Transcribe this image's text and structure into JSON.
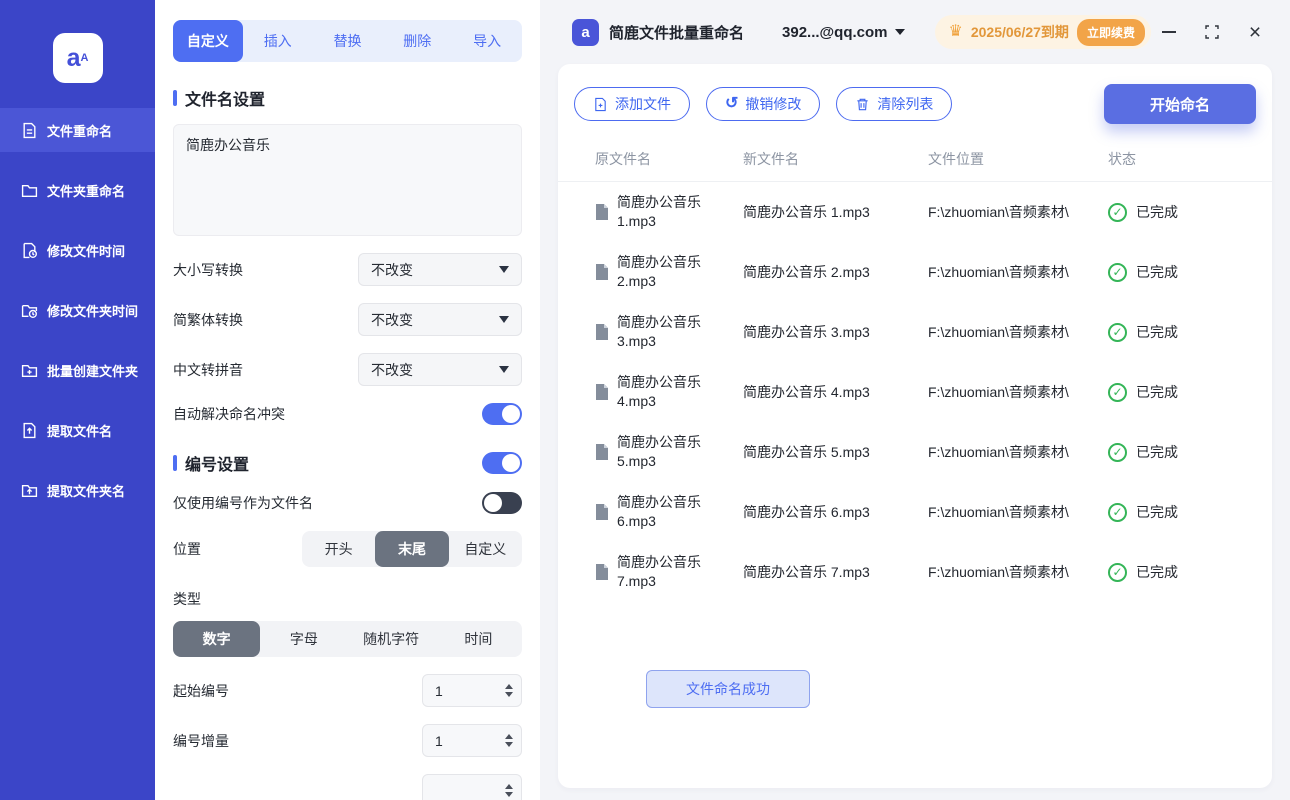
{
  "colors": {
    "accent": "#4e6ef2",
    "sidebar": "#3b45c8",
    "success": "#35b558",
    "warning": "#f0a23c"
  },
  "icons": {
    "check": "✓",
    "undo": "↺",
    "crown": "♛",
    "close": "×"
  },
  "titlebar": {
    "app_title": "简鹿文件批量重命名",
    "account": "392...@qq.com",
    "expiry": "2025/06/27到期",
    "renew": "立即续费"
  },
  "sidebar": {
    "items": [
      {
        "label": "文件重命名"
      },
      {
        "label": "文件夹重命名"
      },
      {
        "label": "修改文件时间"
      },
      {
        "label": "修改文件夹时间"
      },
      {
        "label": "批量创建文件夹"
      },
      {
        "label": "提取文件名"
      },
      {
        "label": "提取文件夹名"
      }
    ]
  },
  "tabs": [
    "自定义",
    "插入",
    "替换",
    "删除",
    "导入"
  ],
  "panel": {
    "filename_title": "文件名设置",
    "filename_value": "简鹿办公音乐",
    "fields": [
      {
        "label": "大小写转换",
        "value": "不改变"
      },
      {
        "label": "简繁体转换",
        "value": "不改变"
      },
      {
        "label": "中文转拼音",
        "value": "不改变"
      }
    ],
    "auto_resolve_label": "自动解决命名冲突",
    "numbering_title": "编号设置",
    "only_number_label": "仅使用编号作为文件名",
    "position": {
      "label": "位置",
      "options": [
        "开头",
        "末尾",
        "自定义"
      ],
      "selected": "末尾"
    },
    "type": {
      "label": "类型",
      "options": [
        "数字",
        "字母",
        "随机字符",
        "时间"
      ],
      "selected": "数字"
    },
    "start_number": {
      "label": "起始编号",
      "value": "1"
    },
    "increment": {
      "label": "编号增量",
      "value": "1"
    }
  },
  "main": {
    "toolbar": {
      "add_files": "添加文件",
      "undo": "撤销修改",
      "clear": "清除列表",
      "start": "开始命名"
    },
    "table": {
      "headers": [
        "原文件名",
        "新文件名",
        "文件位置",
        "状态"
      ],
      "rows": [
        {
          "original": "简鹿办公音乐 1.mp3",
          "new": "简鹿办公音乐 1.mp3",
          "location": "F:\\zhuomian\\音频素材\\",
          "status": "已完成"
        },
        {
          "original": "简鹿办公音乐 2.mp3",
          "new": "简鹿办公音乐 2.mp3",
          "location": "F:\\zhuomian\\音频素材\\",
          "status": "已完成"
        },
        {
          "original": "简鹿办公音乐 3.mp3",
          "new": "简鹿办公音乐 3.mp3",
          "location": "F:\\zhuomian\\音频素材\\",
          "status": "已完成"
        },
        {
          "original": "简鹿办公音乐 4.mp3",
          "new": "简鹿办公音乐 4.mp3",
          "location": "F:\\zhuomian\\音频素材\\",
          "status": "已完成"
        },
        {
          "original": "简鹿办公音乐 5.mp3",
          "new": "简鹿办公音乐 5.mp3",
          "location": "F:\\zhuomian\\音频素材\\",
          "status": "已完成"
        },
        {
          "original": "简鹿办公音乐 6.mp3",
          "new": "简鹿办公音乐 6.mp3",
          "location": "F:\\zhuomian\\音频素材\\",
          "status": "已完成"
        },
        {
          "original": "简鹿办公音乐 7.mp3",
          "new": "简鹿办公音乐 7.mp3",
          "location": "F:\\zhuomian\\音频素材\\",
          "status": "已完成"
        }
      ]
    },
    "footer_message": "文件命名成功"
  }
}
